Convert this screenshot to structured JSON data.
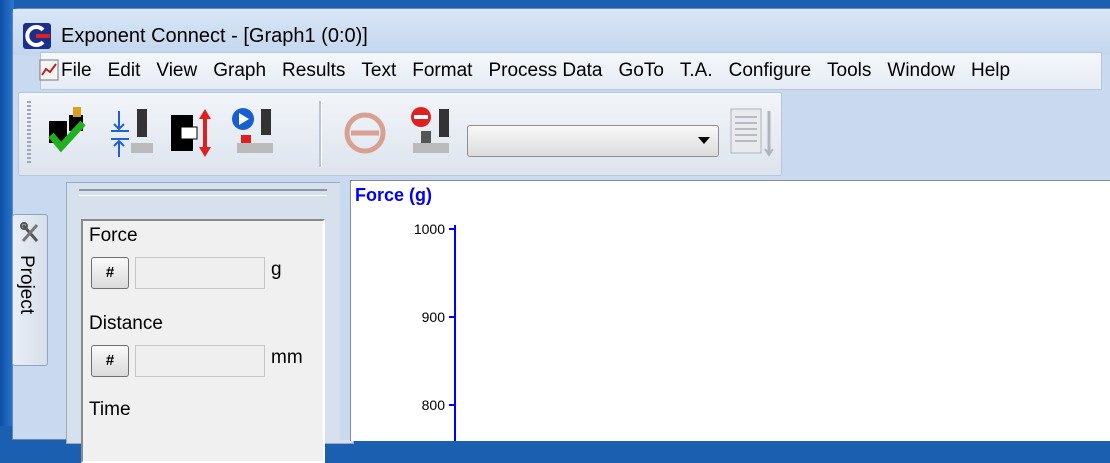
{
  "window": {
    "title": "Exponent Connect - [Graph1 (0:0)]"
  },
  "menu": {
    "items": [
      "File",
      "Edit",
      "View",
      "Graph",
      "Results",
      "Text",
      "Format",
      "Process Data",
      "GoTo",
      "T.A.",
      "Configure",
      "Tools",
      "Window",
      "Help"
    ]
  },
  "toolbar": {
    "buttons": [
      {
        "name": "probe-calibrate-icon"
      },
      {
        "name": "height-calibrate-icon"
      },
      {
        "name": "move-probe-icon"
      },
      {
        "name": "run-test-icon"
      },
      {
        "name": "stop-icon"
      },
      {
        "name": "abort-test-icon"
      }
    ],
    "combo_value": "",
    "report_icon": "document-icon"
  },
  "side_tab": {
    "label": "Project",
    "icon": "tools-icon"
  },
  "fields": [
    {
      "label": "Force",
      "button": "#",
      "value": "",
      "unit": "g"
    },
    {
      "label": "Distance",
      "button": "#",
      "value": "",
      "unit": "mm"
    },
    {
      "label": "Time",
      "button": "#",
      "value": "",
      "unit": ""
    }
  ],
  "chart_data": {
    "type": "line",
    "ylabel": "Force (g)",
    "ytick_labels": [
      "1000",
      "900",
      "800"
    ],
    "yvisible": [
      800,
      1000
    ],
    "series": [],
    "colors": {
      "axis": "#0000ff"
    }
  }
}
